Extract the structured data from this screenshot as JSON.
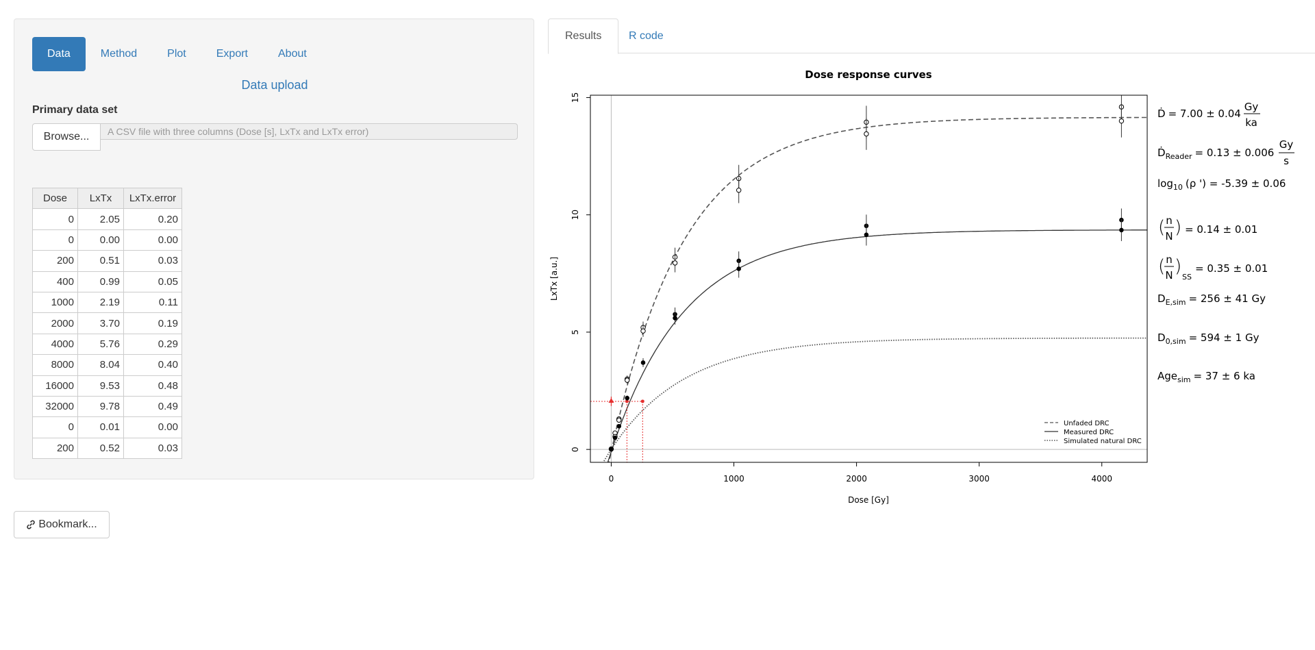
{
  "sidebar": {
    "tabs": [
      {
        "label": "Data",
        "active": true
      },
      {
        "label": "Method",
        "active": false
      },
      {
        "label": "Plot",
        "active": false
      },
      {
        "label": "Export",
        "active": false
      },
      {
        "label": "About",
        "active": false
      }
    ],
    "upload_title": "Data upload",
    "primary_label": "Primary data set",
    "browse_label": "Browse...",
    "file_placeholder": "A CSV file with three columns (Dose [s], LxTx and LxTx error)",
    "table": {
      "columns": [
        "Dose",
        "LxTx",
        "LxTx.error"
      ],
      "rows": [
        [
          "0",
          "2.05",
          "0.20"
        ],
        [
          "0",
          "0.00",
          "0.00"
        ],
        [
          "200",
          "0.51",
          "0.03"
        ],
        [
          "400",
          "0.99",
          "0.05"
        ],
        [
          "1000",
          "2.19",
          "0.11"
        ],
        [
          "2000",
          "3.70",
          "0.19"
        ],
        [
          "4000",
          "5.76",
          "0.29"
        ],
        [
          "8000",
          "8.04",
          "0.40"
        ],
        [
          "16000",
          "9.53",
          "0.48"
        ],
        [
          "32000",
          "9.78",
          "0.49"
        ],
        [
          "0",
          "0.01",
          "0.00"
        ],
        [
          "200",
          "0.52",
          "0.03"
        ]
      ]
    },
    "bookmark_label": "Bookmark...",
    "bookmark_icon": "link-icon"
  },
  "main": {
    "tabs": [
      {
        "label": "Results",
        "active": true
      },
      {
        "label": "R code",
        "active": false
      }
    ]
  },
  "results": {
    "d_dot": {
      "base": "Ḋ",
      "value": "= 7.00 ± 0.04",
      "unit_num": "Gy",
      "unit_den": "ka"
    },
    "d_dot_reader": {
      "base": "Ḋ",
      "sub": "Reader",
      "value": "= 0.13 ± 0.006",
      "unit_num": "Gy",
      "unit_den": "s"
    },
    "log_rho": {
      "base": "log",
      "sub": "10",
      "value": "(ρ ') = -5.39 ± 0.06"
    },
    "n_over_N": {
      "num": "n",
      "den": "N",
      "value": "= 0.14 ± 0.01"
    },
    "n_over_N_ss": {
      "num": "n",
      "den": "N",
      "sub": "SS",
      "value": "= 0.35 ± 0.01"
    },
    "de_sim": {
      "base": "D",
      "sub": "E,sim",
      "value": "= 256 ± 41 Gy"
    },
    "d0_sim": {
      "base": "D",
      "sub": "0,sim",
      "value": "= 594 ± 1 Gy"
    },
    "age_sim": {
      "base": "Age",
      "sub": "sim",
      "value": "= 37 ± 6 ka"
    }
  },
  "chart_data": {
    "type": "line",
    "title": "Dose response curves",
    "xlabel": "Dose [Gy]",
    "ylabel": "LxTx [a.u.]",
    "xlim": [
      -170,
      4370
    ],
    "ylim": [
      -0.55,
      15.1
    ],
    "x_ticks": [
      0,
      1000,
      2000,
      3000,
      4000
    ],
    "y_ticks": [
      0,
      5,
      10,
      15
    ],
    "legend": {
      "position": "bottom-right",
      "entries": [
        "Unfaded DRC",
        "Measured DRC",
        "Simulated natural DRC"
      ]
    },
    "series": [
      {
        "name": "Unfaded DRC",
        "style": "dashed",
        "params": {
          "A": 14.25,
          "D0": 594,
          "c": -0.09
        },
        "points": [
          [
            0,
            0.02
          ],
          [
            31,
            0.7
          ],
          [
            31,
            0.55
          ],
          [
            63,
            1.3
          ],
          [
            63,
            1.25
          ],
          [
            130,
            3.0
          ],
          [
            130,
            2.95
          ],
          [
            260,
            5.2
          ],
          [
            260,
            5.05
          ],
          [
            520,
            8.2
          ],
          [
            520,
            7.95
          ],
          [
            1040,
            11.55
          ],
          [
            1040,
            11.05
          ],
          [
            2080,
            13.95
          ],
          [
            2080,
            13.45
          ],
          [
            4160,
            14.6
          ],
          [
            4160,
            14.0
          ]
        ],
        "errors": [
          0.05,
          0.04,
          0.04,
          0.06,
          0.06,
          0.15,
          0.15,
          0.25,
          0.25,
          0.4,
          0.4,
          0.58,
          0.55,
          0.7,
          0.68,
          0.73,
          0.7
        ]
      },
      {
        "name": "Measured DRC",
        "style": "solid",
        "params": {
          "A": 9.45,
          "D0": 594,
          "c": -0.09
        },
        "points": [
          [
            0,
            0.0
          ],
          [
            31,
            0.5
          ],
          [
            63,
            0.99
          ],
          [
            130,
            2.19
          ],
          [
            260,
            3.7
          ],
          [
            520,
            5.76
          ],
          [
            520,
            5.6
          ],
          [
            1040,
            8.04
          ],
          [
            1040,
            7.7
          ],
          [
            2080,
            9.53
          ],
          [
            2080,
            9.15
          ],
          [
            4160,
            9.78
          ],
          [
            4160,
            9.35
          ]
        ],
        "errors": [
          0.0,
          0.03,
          0.05,
          0.11,
          0.19,
          0.29,
          0.28,
          0.4,
          0.38,
          0.48,
          0.46,
          0.49,
          0.47
        ]
      },
      {
        "name": "Simulated natural DRC",
        "style": "dotted",
        "params": {
          "A": 4.75,
          "D0": 594,
          "c": 0
        }
      }
    ],
    "natural_ltx": 2.05,
    "natural_error": 0.2,
    "de_points": [
      {
        "dose": 128,
        "lxtx": 2.05
      },
      {
        "dose": 256,
        "lxtx": 2.05
      }
    ]
  }
}
